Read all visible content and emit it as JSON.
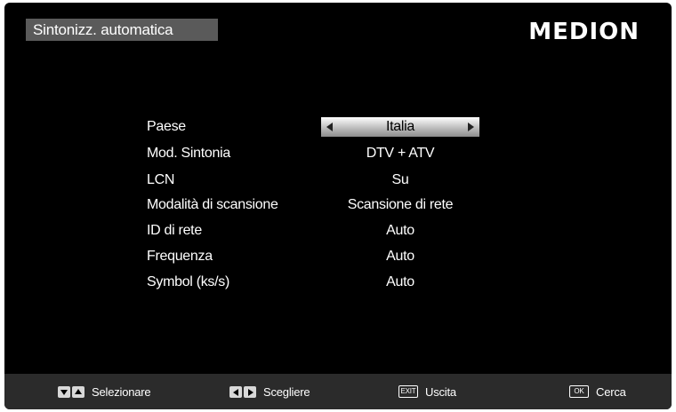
{
  "header": {
    "title": "Sintonizz. automatica",
    "brand": "MEDION"
  },
  "menu": {
    "rows": [
      {
        "label": "Paese",
        "value": "Italia",
        "selected": true
      },
      {
        "label": "Mod. Sintonia",
        "value": "DTV + ATV"
      },
      {
        "label": "LCN",
        "value": "Su"
      },
      {
        "label": "Modalità di scansione",
        "value": "Scansione di rete"
      },
      {
        "label": "ID di rete",
        "value": "Auto"
      },
      {
        "label": "Frequenza",
        "value": "Auto"
      },
      {
        "label": "Symbol (ks/s)",
        "value": "Auto"
      }
    ]
  },
  "footer": {
    "select": {
      "label": "Selezionare",
      "icon": "up-down-arrow-icon"
    },
    "choose": {
      "label": "Scegliere",
      "icon": "left-right-arrow-icon"
    },
    "exit": {
      "label": "Uscita",
      "key": "EXIT"
    },
    "search": {
      "label": "Cerca",
      "key": "OK"
    }
  },
  "colors": {
    "background": "#000000",
    "title_bar": "#5a5a5a",
    "footer_bar": "#2b2b2b",
    "selected_value": "#c8c8c8"
  }
}
